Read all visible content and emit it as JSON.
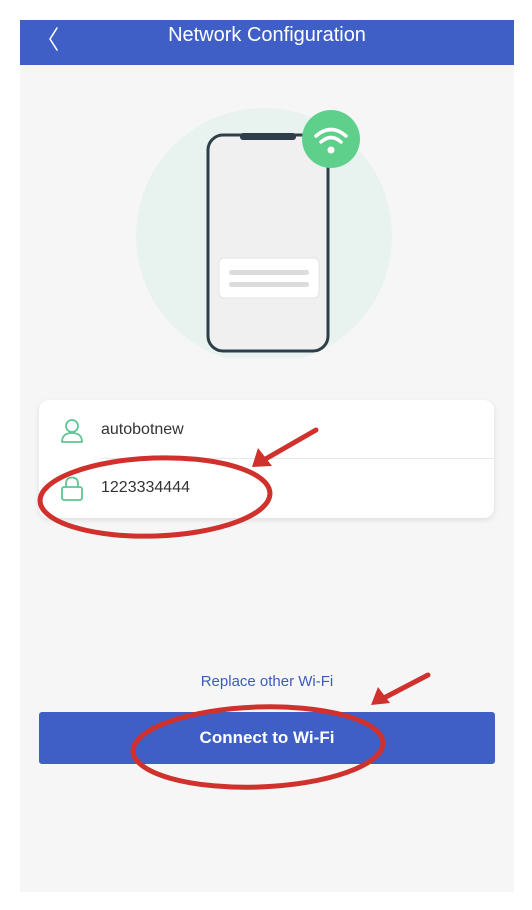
{
  "header": {
    "title": "Network Configuration",
    "back_icon": "chevron-left-icon",
    "background": "#3f5fc6"
  },
  "illustration": {
    "icons": [
      "phone-icon",
      "wifi-icon"
    ],
    "circle_color": "#e8f3ef",
    "wifi_badge_color": "#5fd08c"
  },
  "credentials": {
    "ssid": {
      "icon": "user-icon",
      "value": "autobotnew"
    },
    "password": {
      "icon": "lock-icon",
      "value": "1223334444"
    },
    "icon_color": "#5fc592"
  },
  "actions": {
    "replace_label": "Replace other Wi-Fi",
    "connect_label": "Connect to Wi-Fi",
    "accent": "#3f5fc6"
  },
  "annotations": {
    "color": "#d0312d",
    "marks": [
      "arrow",
      "circle-around-password",
      "arrow",
      "circle-around-connect-button"
    ]
  }
}
